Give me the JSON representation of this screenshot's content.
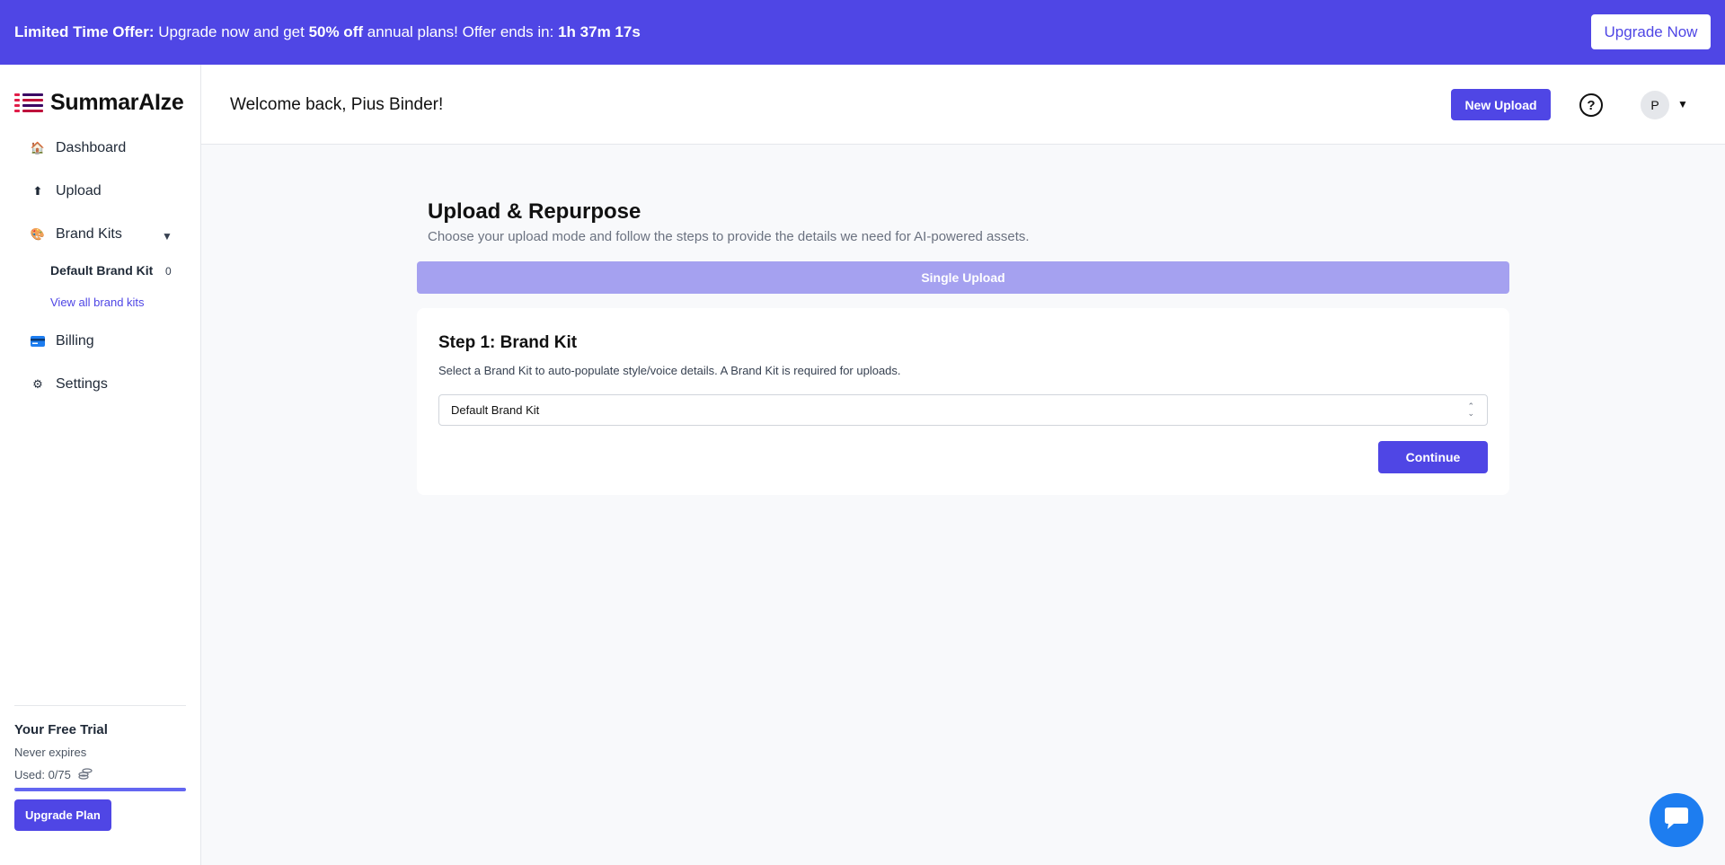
{
  "promo": {
    "label": "Limited Time Offer:",
    "text_1": " Upgrade now and get ",
    "discount": "50% off",
    "text_2": " annual plans! Offer ends in: ",
    "countdown": "1h 37m 17s",
    "button": "Upgrade Now"
  },
  "brand": {
    "name": "SummarAIze"
  },
  "sidebar": {
    "dashboard": "Dashboard",
    "upload": "Upload",
    "brand_kits": "Brand Kits",
    "default_kit": "Default Brand Kit",
    "default_kit_count": "0",
    "view_all": "View all brand kits",
    "billing": "Billing",
    "settings": "Settings"
  },
  "trial": {
    "title": "Your Free Trial",
    "expiry": "Never expires",
    "used": "Used: 0/75",
    "used_fraction": 0,
    "button": "Upgrade Plan"
  },
  "header": {
    "welcome": "Welcome back, Pius Binder!",
    "new_upload": "New Upload",
    "help": "?",
    "avatar_initial": "P"
  },
  "main": {
    "title": "Upload & Repurpose",
    "description": "Choose your upload mode and follow the steps to provide the details we need for AI-powered assets.",
    "mode_tab": "Single Upload",
    "step_title": "Step 1: Brand Kit",
    "step_desc": "Select a Brand Kit to auto-populate style/voice details. A Brand Kit is required for uploads.",
    "selected_kit": "Default Brand Kit",
    "continue": "Continue"
  },
  "colors": {
    "primary": "#4f46e5",
    "mode_tab": "#a5a1f0",
    "chat": "#1d7df0"
  }
}
